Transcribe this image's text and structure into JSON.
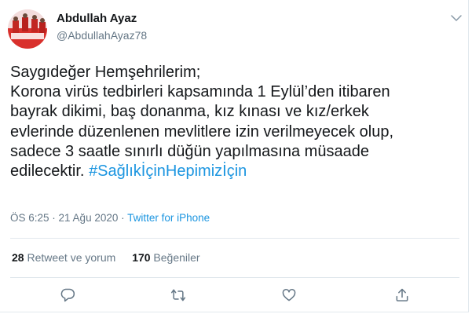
{
  "author": {
    "display_name": "Abdullah Ayaz",
    "handle": "@AbdullahAyaz78"
  },
  "tweet": {
    "lines": [
      "Saygıdeğer Hemşehrilerim;",
      "Korona virüs tedbirleri kapsamında 1 Eylül’den itibaren",
      "bayrak dikimi,  baş donanma, kız kınası ve kız/erkek",
      "evlerinde düzenlenen mevlitlere izin verilmeyecek olup,",
      "sadece 3 saatle sınırlı düğün yapılmasına müsaade"
    ],
    "last_line_text": "edilecektir. ",
    "hashtag": "#SağlıkİçinHepimizİçin"
  },
  "meta": {
    "time": "ÖS 6:25",
    "separator": " · ",
    "date": "21 Ağu 2020",
    "separator2": " · ",
    "source": "Twitter for iPhone"
  },
  "stats": {
    "retweets_count": "28",
    "retweets_label": " Retweet ve yorum",
    "likes_count": "170",
    "likes_label": " Beğeniler"
  },
  "icons": {
    "menu": "chevron-down-icon",
    "reply": "reply-icon",
    "retweet": "retweet-icon",
    "like": "heart-icon",
    "share": "share-icon"
  },
  "colors": {
    "link": "#1b95e0",
    "secondary_text": "#657786",
    "primary_text": "#14171a",
    "divider": "#e1e8ed"
  }
}
